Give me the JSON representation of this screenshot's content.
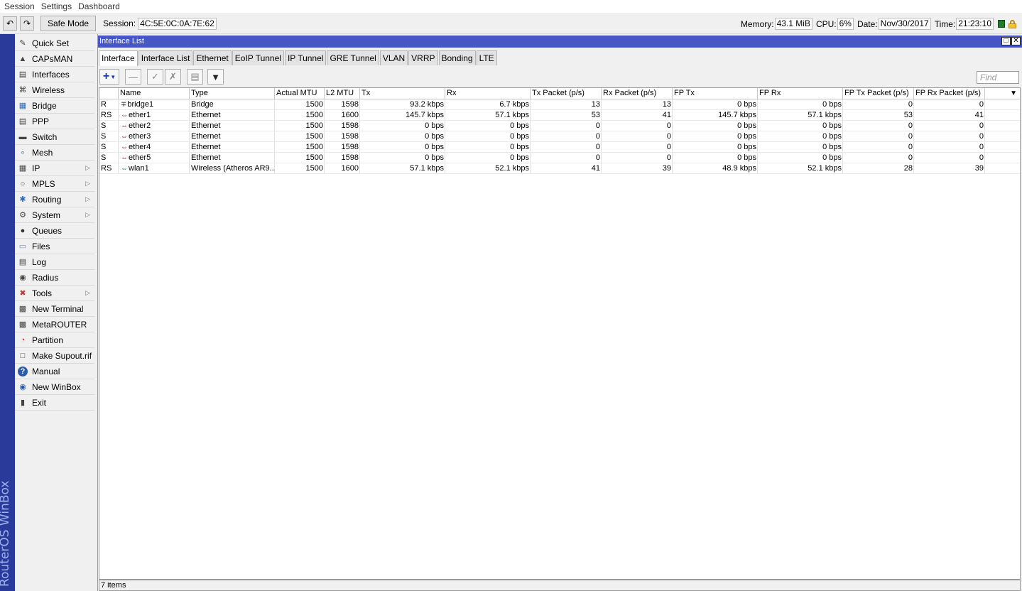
{
  "menu": [
    "Session",
    "Settings",
    "Dashboard"
  ],
  "toolbar": {
    "safe_mode": "Safe Mode",
    "session_label": "Session:",
    "session_value": "4C:5E:0C:0A:7E:62",
    "memory_label": "Memory:",
    "memory_value": "43.1 MiB",
    "cpu_label": "CPU:",
    "cpu_value": "6%",
    "date_label": "Date:",
    "date_value": "Nov/30/2017",
    "time_label": "Time:",
    "time_value": "21:23:10"
  },
  "brand": "RouterOS WinBox",
  "sidebar": [
    {
      "label": "Quick Set",
      "icon": "quick-set-icon",
      "arrow": false
    },
    {
      "label": "CAPsMAN",
      "icon": "capsman-icon",
      "arrow": false
    },
    {
      "label": "Interfaces",
      "icon": "interfaces-icon",
      "arrow": false
    },
    {
      "label": "Wireless",
      "icon": "wireless-icon",
      "arrow": false
    },
    {
      "label": "Bridge",
      "icon": "bridge-icon",
      "arrow": false
    },
    {
      "label": "PPP",
      "icon": "ppp-icon",
      "arrow": false
    },
    {
      "label": "Switch",
      "icon": "switch-icon",
      "arrow": false
    },
    {
      "label": "Mesh",
      "icon": "mesh-icon",
      "arrow": false
    },
    {
      "label": "IP",
      "icon": "ip-icon",
      "arrow": true
    },
    {
      "label": "MPLS",
      "icon": "mpls-icon",
      "arrow": true
    },
    {
      "label": "Routing",
      "icon": "routing-icon",
      "arrow": true
    },
    {
      "label": "System",
      "icon": "gear-icon",
      "arrow": true
    },
    {
      "label": "Queues",
      "icon": "queues-icon",
      "arrow": false
    },
    {
      "label": "Files",
      "icon": "folder-icon",
      "arrow": false
    },
    {
      "label": "Log",
      "icon": "log-icon",
      "arrow": false
    },
    {
      "label": "Radius",
      "icon": "radius-icon",
      "arrow": false
    },
    {
      "label": "Tools",
      "icon": "tools-icon",
      "arrow": true
    },
    {
      "label": "New Terminal",
      "icon": "terminal-icon",
      "arrow": false
    },
    {
      "label": "MetaROUTER",
      "icon": "metarouter-icon",
      "arrow": false
    },
    {
      "label": "Partition",
      "icon": "partition-icon",
      "arrow": false
    },
    {
      "label": "Make Supout.rif",
      "icon": "document-icon",
      "arrow": false
    },
    {
      "label": "Manual",
      "icon": "help-icon",
      "arrow": false
    },
    {
      "label": "New WinBox",
      "icon": "winbox-icon",
      "arrow": false
    },
    {
      "label": "Exit",
      "icon": "exit-icon",
      "arrow": false
    }
  ],
  "window": {
    "title": "Interface List",
    "tabs": [
      "Interface",
      "Interface List",
      "Ethernet",
      "EoIP Tunnel",
      "IP Tunnel",
      "GRE Tunnel",
      "VLAN",
      "VRRP",
      "Bonding",
      "LTE"
    ],
    "active_tab": "Interface",
    "find_placeholder": "Find",
    "status": "7 items"
  },
  "table": {
    "columns": [
      "",
      "Name",
      "Type",
      "Actual MTU",
      "L2 MTU",
      "Tx",
      "Rx",
      "Tx Packet (p/s)",
      "Rx Packet (p/s)",
      "FP Tx",
      "FP Rx",
      "FP Tx Packet (p/s)",
      "FP Rx Packet (p/s)"
    ],
    "rows": [
      {
        "flags": "R",
        "name": "bridge1",
        "icon": "bridge-icon",
        "type": "Bridge",
        "mtu": "1500",
        "l2mtu": "1598",
        "tx": "93.2 kbps",
        "rx": "6.7 kbps",
        "txp": "13",
        "rxp": "13",
        "fptx": "0 bps",
        "fprx": "0 bps",
        "fptxp": "0",
        "fprxp": "0"
      },
      {
        "flags": "RS",
        "name": "ether1",
        "icon": "ethernet-icon",
        "type": "Ethernet",
        "mtu": "1500",
        "l2mtu": "1600",
        "tx": "145.7 kbps",
        "rx": "57.1 kbps",
        "txp": "53",
        "rxp": "41",
        "fptx": "145.7 kbps",
        "fprx": "57.1 kbps",
        "fptxp": "53",
        "fprxp": "41"
      },
      {
        "flags": "S",
        "name": "ether2",
        "icon": "ethernet-icon",
        "type": "Ethernet",
        "mtu": "1500",
        "l2mtu": "1598",
        "tx": "0 bps",
        "rx": "0 bps",
        "txp": "0",
        "rxp": "0",
        "fptx": "0 bps",
        "fprx": "0 bps",
        "fptxp": "0",
        "fprxp": "0"
      },
      {
        "flags": "S",
        "name": "ether3",
        "icon": "ethernet-icon",
        "type": "Ethernet",
        "mtu": "1500",
        "l2mtu": "1598",
        "tx": "0 bps",
        "rx": "0 bps",
        "txp": "0",
        "rxp": "0",
        "fptx": "0 bps",
        "fprx": "0 bps",
        "fptxp": "0",
        "fprxp": "0"
      },
      {
        "flags": "S",
        "name": "ether4",
        "icon": "ethernet-icon",
        "type": "Ethernet",
        "mtu": "1500",
        "l2mtu": "1598",
        "tx": "0 bps",
        "rx": "0 bps",
        "txp": "0",
        "rxp": "0",
        "fptx": "0 bps",
        "fprx": "0 bps",
        "fptxp": "0",
        "fprxp": "0"
      },
      {
        "flags": "S",
        "name": "ether5",
        "icon": "ethernet-icon",
        "type": "Ethernet",
        "mtu": "1500",
        "l2mtu": "1598",
        "tx": "0 bps",
        "rx": "0 bps",
        "txp": "0",
        "rxp": "0",
        "fptx": "0 bps",
        "fprx": "0 bps",
        "fptxp": "0",
        "fprxp": "0"
      },
      {
        "flags": "RS",
        "name": "wlan1",
        "icon": "wireless-icon",
        "type": "Wireless (Atheros AR9...",
        "mtu": "1500",
        "l2mtu": "1600",
        "tx": "57.1 kbps",
        "rx": "52.1 kbps",
        "txp": "41",
        "rxp": "39",
        "fptx": "48.9 kbps",
        "fprx": "52.1 kbps",
        "fptxp": "28",
        "fprxp": "39"
      }
    ]
  }
}
